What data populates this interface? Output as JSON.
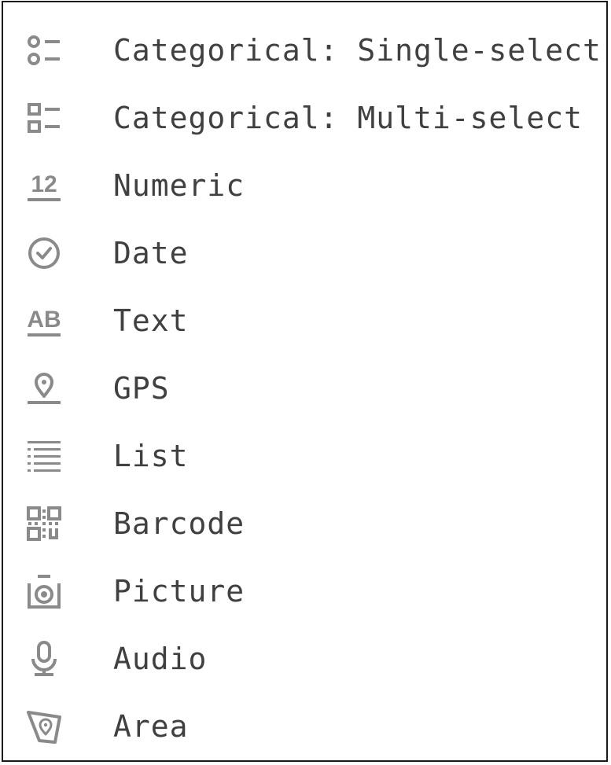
{
  "menu": {
    "items": [
      {
        "label": "Categorical: Single-select",
        "icon": "single-select-icon"
      },
      {
        "label": "Categorical: Multi-select",
        "icon": "multi-select-icon"
      },
      {
        "label": "Numeric",
        "icon": "numeric-icon"
      },
      {
        "label": "Date",
        "icon": "clock-icon"
      },
      {
        "label": "Text",
        "icon": "text-icon"
      },
      {
        "label": "GPS",
        "icon": "location-pin-icon"
      },
      {
        "label": "List",
        "icon": "list-icon"
      },
      {
        "label": "Barcode",
        "icon": "qr-code-icon"
      },
      {
        "label": "Picture",
        "icon": "camera-icon"
      },
      {
        "label": "Audio",
        "icon": "microphone-icon"
      },
      {
        "label": "Area",
        "icon": "area-map-icon"
      }
    ]
  },
  "colors": {
    "icon": "#8a8a8a",
    "text": "#404040",
    "border": "#1a1a1a"
  }
}
